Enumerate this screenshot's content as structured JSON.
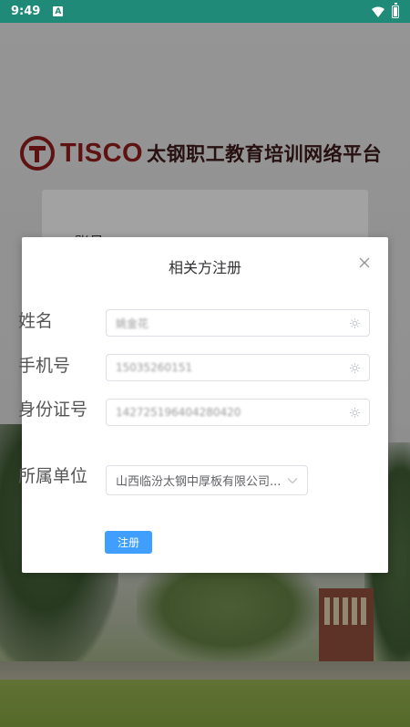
{
  "status_bar": {
    "time": "9:49",
    "notification_letter": "A",
    "icons": [
      "a-notification-icon",
      "wifi-icon",
      "battery-icon"
    ]
  },
  "header": {
    "brand": "TISCO",
    "platform_title": "太钢职工教育培训网络平台"
  },
  "background_form": {
    "partial_label": "账号"
  },
  "dialog": {
    "title": "相关方注册",
    "fields": {
      "name": {
        "label": "姓名",
        "value": "姚金花"
      },
      "phone": {
        "label": "手机号",
        "value": "15035260151"
      },
      "id_card": {
        "label": "身份证号",
        "value": "142725196404280420"
      },
      "unit": {
        "label": "所属单位",
        "value": "山西临汾太钢中厚板有限公司..."
      }
    },
    "submit_label": "注册"
  },
  "colors": {
    "status_bar": "#1e8a77",
    "brand_red": "#8b1b1b",
    "primary_button": "#409eff"
  }
}
